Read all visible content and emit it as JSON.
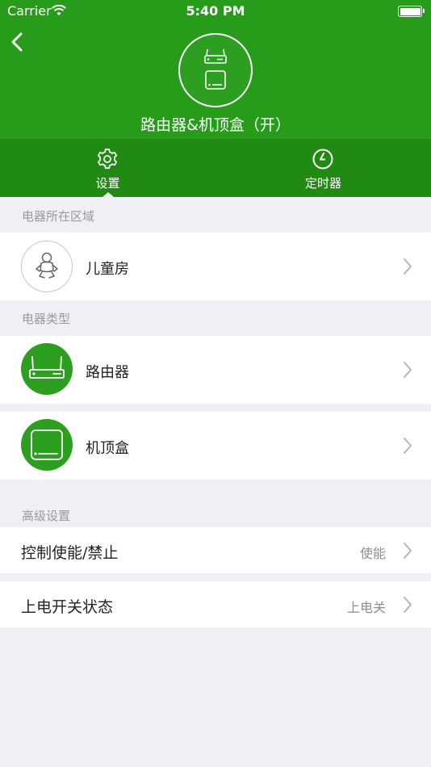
{
  "status_bar": {
    "carrier": "Carrier",
    "time": "5:40 PM"
  },
  "header": {
    "title": "路由器&机顶盒（开）",
    "device_icons": [
      "router-icon",
      "set-top-box-icon"
    ],
    "back_icon": "chevron-left-icon"
  },
  "tabs": [
    {
      "label": "设置",
      "icon": "gear-icon",
      "selected": true
    },
    {
      "label": "定时器",
      "icon": "clock-icon",
      "selected": false
    }
  ],
  "sections": {
    "area": {
      "label": "电器所在区域",
      "item": {
        "name": "儿童房",
        "icon": "baby-icon"
      }
    },
    "type": {
      "label": "电器类型",
      "items": [
        {
          "name": "路由器",
          "icon": "router-icon"
        },
        {
          "name": "机顶盒",
          "icon": "set-top-box-icon"
        }
      ]
    },
    "advanced": {
      "label": "高级设置",
      "items": [
        {
          "name": "控制使能/禁止",
          "value": "使能"
        },
        {
          "name": "上电开关状态",
          "value": "上电关"
        }
      ]
    }
  },
  "colors": {
    "header_green": "#279b1a",
    "tabbar_green": "#208a13",
    "icon_green": "#2c9f20",
    "background": "#efeff4"
  }
}
